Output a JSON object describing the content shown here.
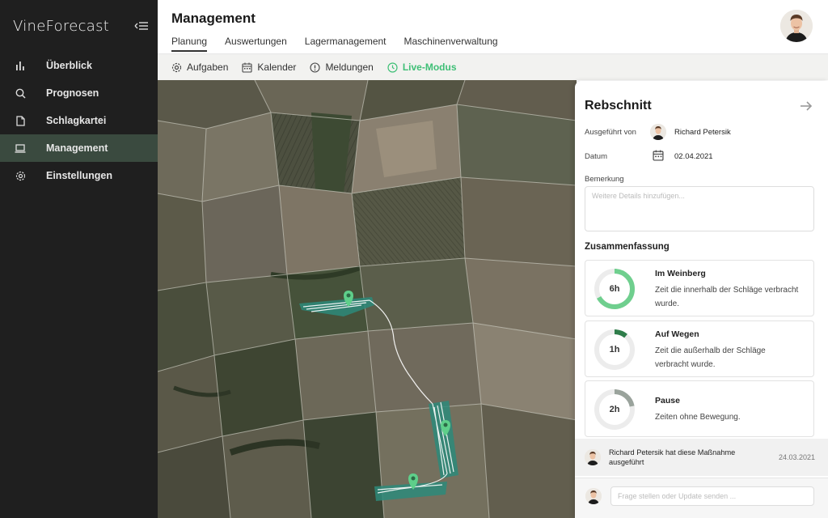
{
  "app": {
    "logo_text": "VineForecast"
  },
  "sidebar": {
    "items": [
      {
        "label": "Überblick",
        "icon": "bar-chart-icon",
        "active": false
      },
      {
        "label": "Prognosen",
        "icon": "search-icon",
        "active": false
      },
      {
        "label": "Schlagkartei",
        "icon": "document-icon",
        "active": false
      },
      {
        "label": "Management",
        "icon": "laptop-icon",
        "active": true
      },
      {
        "label": "Einstellungen",
        "icon": "gear-icon",
        "active": false
      }
    ]
  },
  "header": {
    "title": "Management",
    "tabs": [
      {
        "label": "Planung",
        "active": true
      },
      {
        "label": "Auswertungen",
        "active": false
      },
      {
        "label": "Lagermanagement",
        "active": false
      },
      {
        "label": "Maschinenverwaltung",
        "active": false
      }
    ]
  },
  "subnav": {
    "items": [
      {
        "label": "Aufgaben",
        "icon": "gear-icon"
      },
      {
        "label": "Kalender",
        "icon": "calendar-icon"
      },
      {
        "label": "Meldungen",
        "icon": "info-icon"
      },
      {
        "label": "Live-Modus",
        "icon": "clock-icon"
      }
    ]
  },
  "panel": {
    "title": "Rebschnitt",
    "executed_by_label": "Ausgeführt von",
    "executed_by_name": "Richard Petersik",
    "date_label": "Datum",
    "date_value": "02.04.2021",
    "remark_label": "Bemerkung",
    "remark_placeholder": "Weitere Details hinzufügen...",
    "summary_title": "Zusammenfassung",
    "cards": [
      {
        "value_label": "6h",
        "title": "Im Weinberg",
        "description": "Zeit die innerhalb der Schläge verbracht wurde.",
        "fraction": 0.67,
        "color": "#6fcf8e"
      },
      {
        "value_label": "1h",
        "title": "Auf Wegen",
        "description": "Zeit die außerhalb der Schläge verbracht wurde.",
        "fraction": 0.11,
        "color": "#2f7d4a"
      },
      {
        "value_label": "2h",
        "title": "Pause",
        "description": "Zeiten ohne Bewegung.",
        "fraction": 0.22,
        "color": "#9aa39c"
      }
    ],
    "activity": {
      "text": "Richard Petersik hat diese Maßnahme ausgeführt",
      "date": "24.03.2021"
    },
    "comment_placeholder": "Frage stellen oder Update senden ..."
  },
  "colors": {
    "accent": "#3fbf76",
    "sidebar_bg": "#1f1f1f",
    "sidebar_active": "#3a4a3f"
  }
}
